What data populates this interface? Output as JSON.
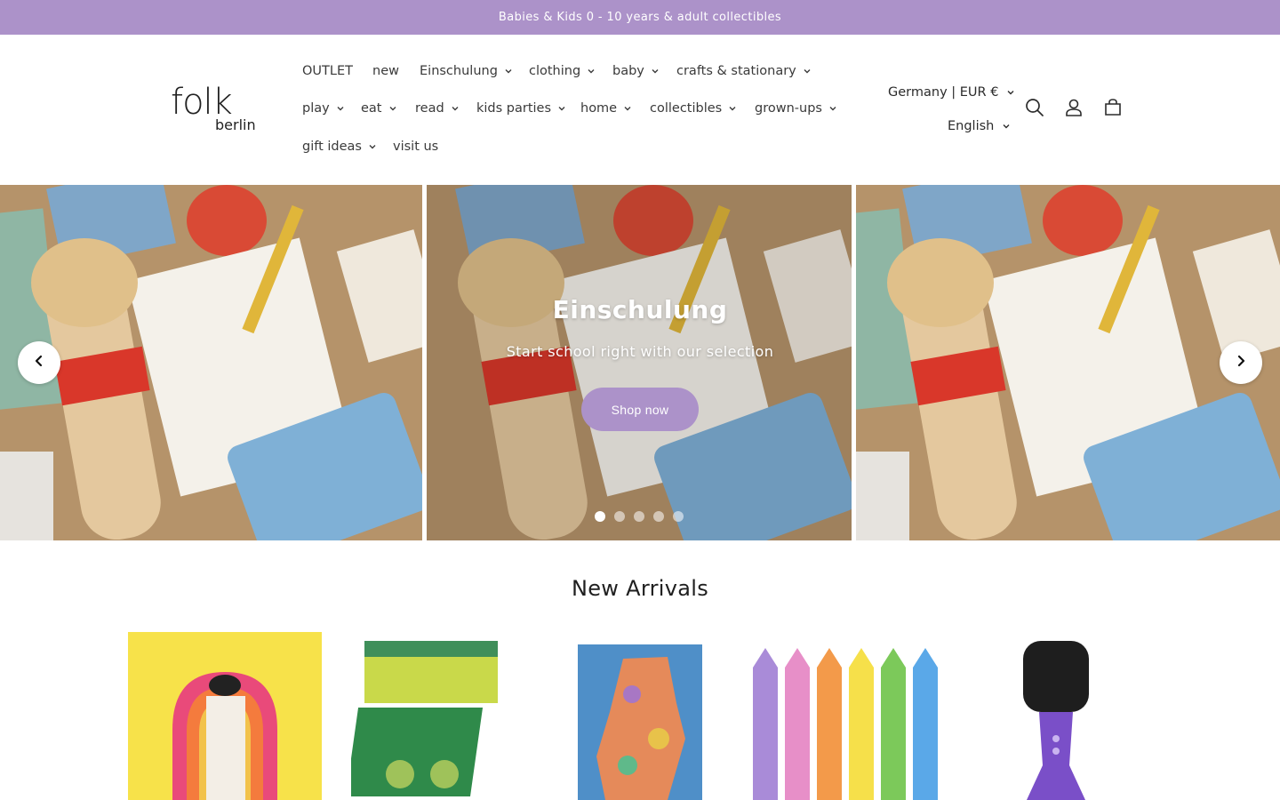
{
  "announcement": "Babies & Kids 0 - 10 years & adult collectibles",
  "brand": {
    "line1": "folk",
    "line2": "berlin"
  },
  "nav": {
    "outlet": "OUTLET",
    "new": "new",
    "einschulung": "Einschulung",
    "clothing": "clothing",
    "baby": "baby",
    "crafts": "crafts & stationary",
    "play": "play",
    "eat": "eat",
    "read": "read",
    "kids_parties": "kids parties",
    "home": "home",
    "collectibles": "collectibles",
    "grown_ups": "grown-ups",
    "gift_ideas": "gift ideas",
    "visit_us": "visit us"
  },
  "locale": {
    "country": "Germany | EUR €",
    "language": "English"
  },
  "icons": {
    "search": "search-icon",
    "account": "account-icon",
    "cart": "cart-icon",
    "prev": "chevron-left-icon",
    "next": "chevron-right-icon"
  },
  "hero": {
    "title": "Einschulung",
    "subtitle": "Start school right with our selection",
    "button": "Shop now",
    "slides_total": 5,
    "active_slide": 1
  },
  "section": {
    "title": "New Arrivals"
  },
  "colors": {
    "accent": "#ac92c9",
    "text": "#2b2b2b",
    "background": "#ffffff"
  }
}
